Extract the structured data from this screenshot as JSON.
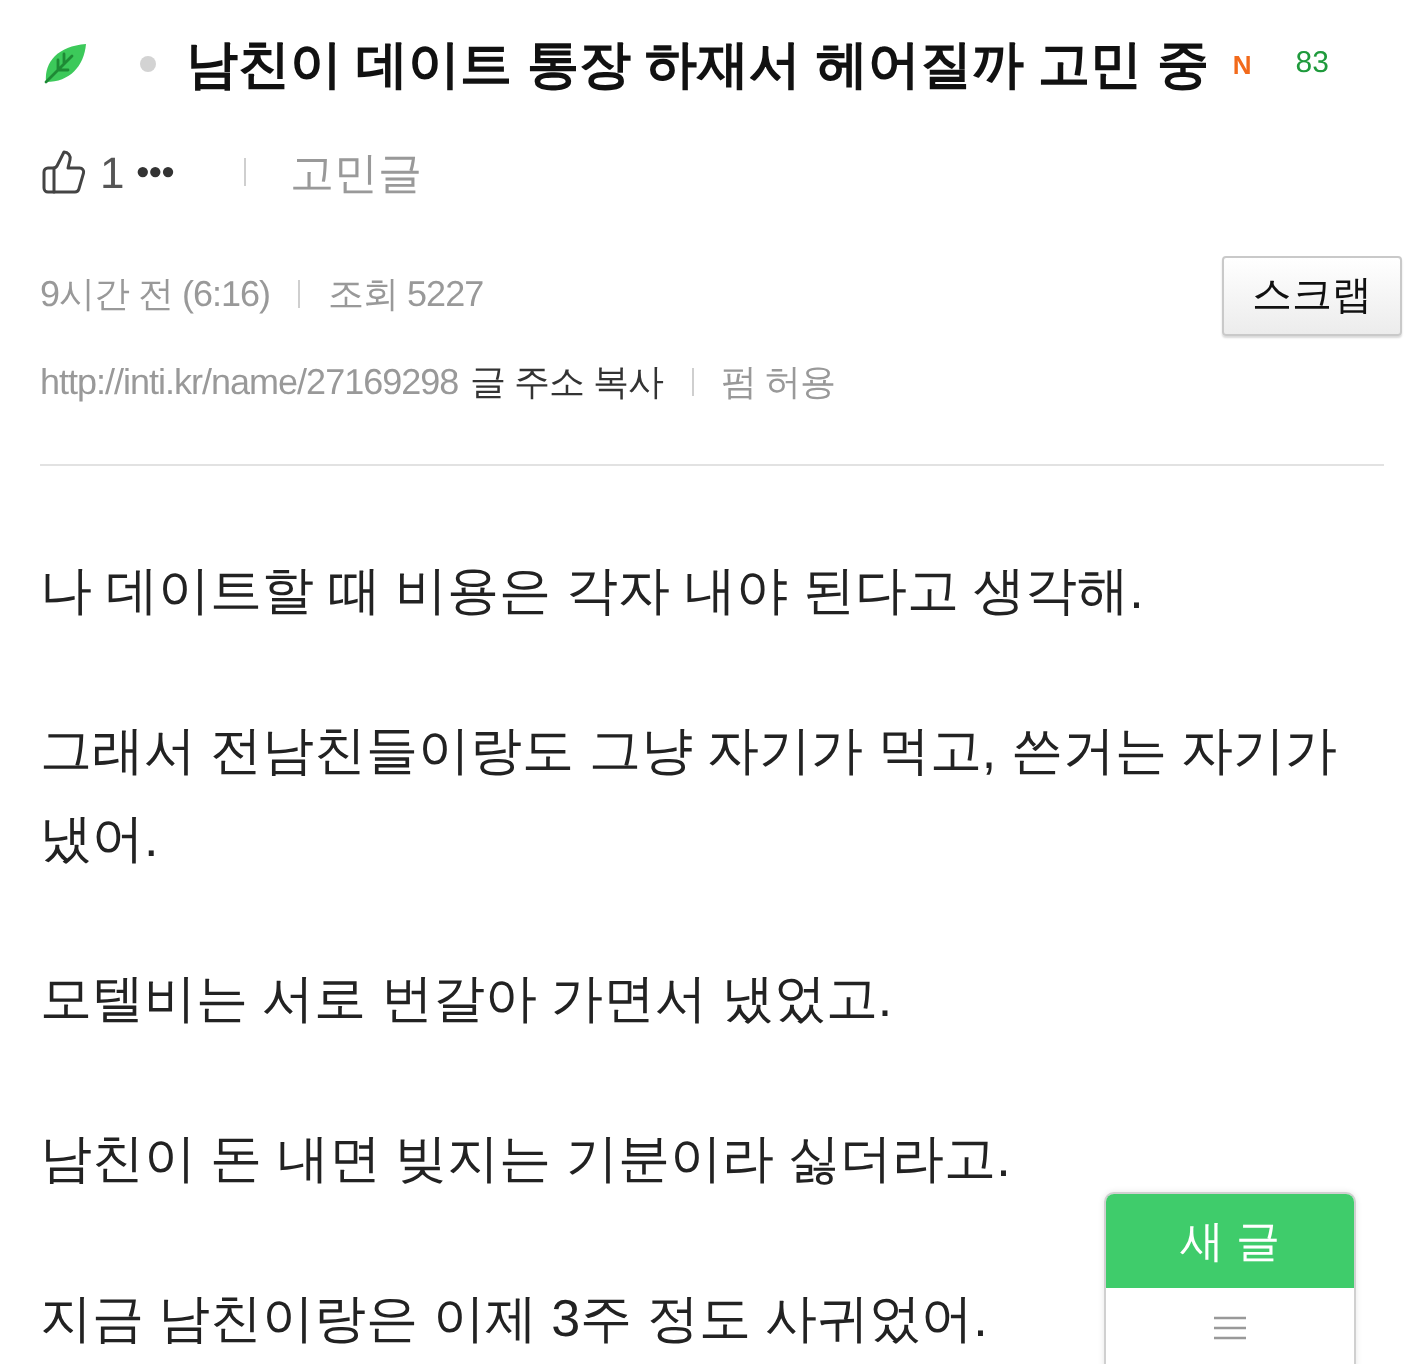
{
  "header": {
    "title": "남친이 데이트 통장 하재서 헤어질까 고민 중",
    "badge": "N",
    "count": "83"
  },
  "meta": {
    "likes": "1",
    "more": "•••",
    "category": "고민글",
    "time": "9시간 전 (6:16)",
    "views": "조회 5227",
    "url": "http://inti.kr/name/27169298",
    "copy_link": "글 주소 복사",
    "permission": "펌 허용",
    "scrap_button": "스크랩"
  },
  "body": {
    "paragraphs": [
      "나 데이트할 때 비용은 각자 내야 된다고 생각해.",
      "그래서 전남친들이랑도 그냥 자기가 먹고, 쓴거는 자기가 냈어.",
      "모텔비는 서로 번갈아 가면서 냈었고.",
      "남친이 돈 내면 빚지는 기분이라 싫더라고.",
      "지금 남친이랑은 이제 3주 정도 사귀었어."
    ]
  },
  "floating_menu": {
    "new_post": "새 글"
  }
}
